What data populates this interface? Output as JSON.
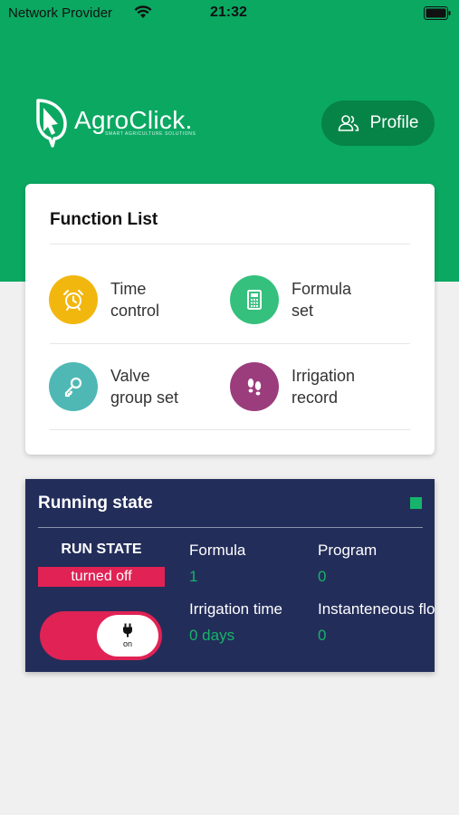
{
  "status_bar": {
    "carrier": "Network Provider",
    "time": "21:32",
    "wifi_icon": "wifi-icon",
    "battery_icon": "battery-icon"
  },
  "header": {
    "logo_text": "AgroClick.",
    "logo_tagline": "SMART AGRICULTURE SOLUTIONS",
    "profile_label": "Profile",
    "brand_color": "#0ba862"
  },
  "function_list": {
    "title": "Function List",
    "items": [
      {
        "line1": "Time",
        "line2": "control",
        "icon": "alarm-clock-icon",
        "color": "#f2b70f"
      },
      {
        "line1": "Formula",
        "line2": "set",
        "icon": "calculator-icon",
        "color": "#35c07d"
      },
      {
        "line1": "Valve",
        "line2": "group set",
        "icon": "key-icon",
        "color": "#4fb8b5"
      },
      {
        "line1": "Irrigation",
        "line2": "record",
        "icon": "footprints-icon",
        "color": "#9b3d7d"
      }
    ]
  },
  "running_state": {
    "title": "Running state",
    "run_state_label": "RUN STATE",
    "run_state_value": "turned off",
    "toggle_label": "on",
    "panel_color": "#232d5a",
    "alert_color": "#e02254",
    "value_color": "#16b46a",
    "stats": {
      "formula_label": "Formula",
      "formula_value": "1",
      "program_label": "Program",
      "program_value": "0",
      "irrigation_time_label": "Irrigation time",
      "irrigation_time_value": "0 days",
      "flow_label": "Instanteneous flow",
      "flow_value": "0"
    }
  }
}
